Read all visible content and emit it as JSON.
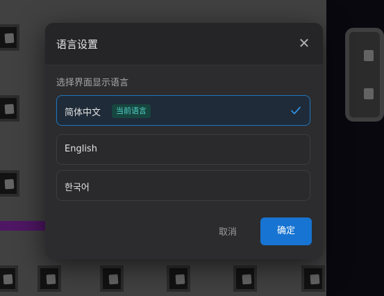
{
  "dialog": {
    "title": "语言设置",
    "close_icon": "close-icon",
    "subtitle": "选择界面显示语言",
    "options": [
      {
        "label": "简体中文",
        "badge": "当前语言",
        "selected": true
      },
      {
        "label": "English",
        "selected": false
      },
      {
        "label": "한국어",
        "selected": false
      }
    ],
    "cancel_label": "取消",
    "confirm_label": "确定"
  },
  "colors": {
    "accent": "#1774d2",
    "badge_text": "#4fd1c5",
    "dialog_bg": "#2c2c2e"
  }
}
